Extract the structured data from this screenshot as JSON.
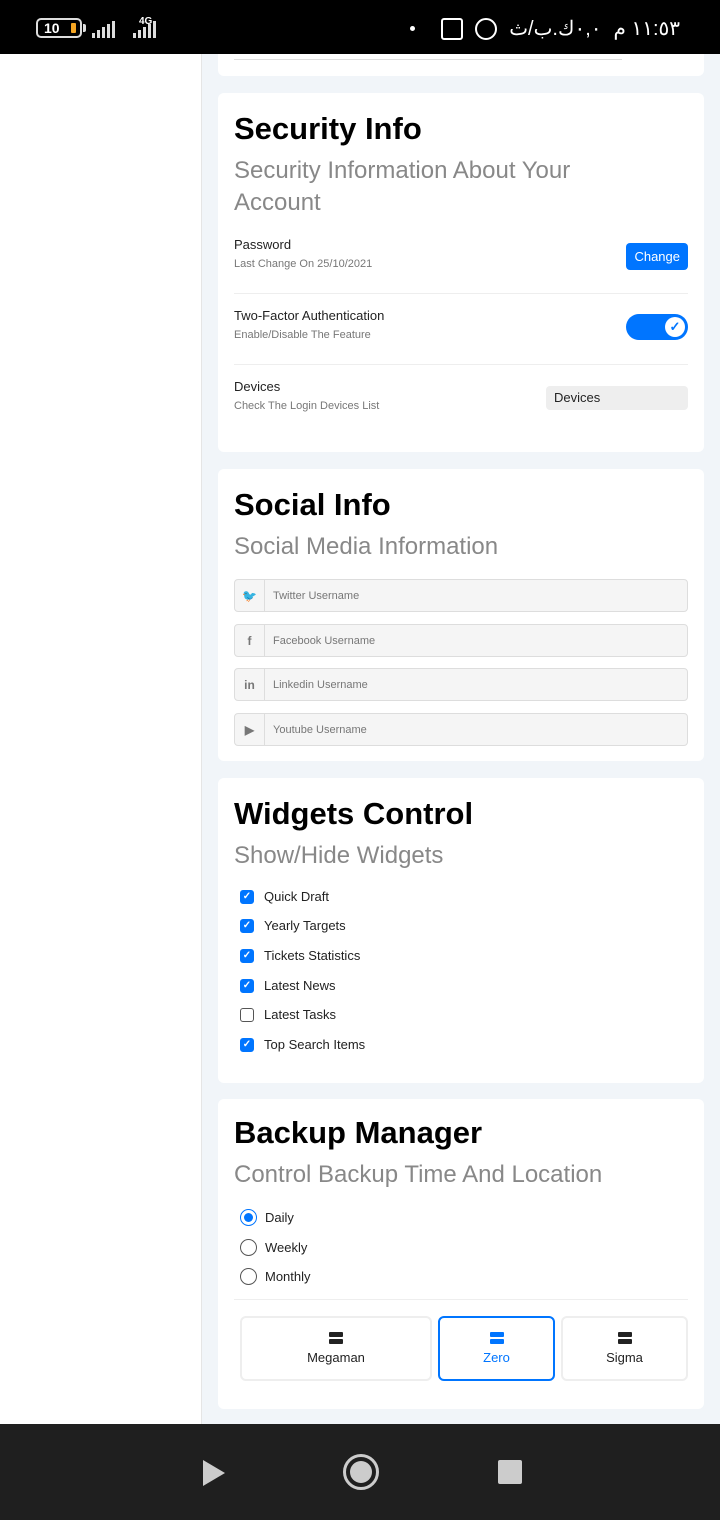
{
  "status_bar": {
    "battery": "10",
    "network": "4G",
    "date_text": "٠,٠ك.ب/ث",
    "time": "١١:٥٣ م"
  },
  "security": {
    "title": "Security Info",
    "subtitle": "Security Information About Your Account",
    "password_label": "Password",
    "password_desc": "Last Change On 25/10/2021",
    "change_label": "Change",
    "twofa_label": "Two-Factor Authentication",
    "twofa_desc": "Enable/Disable The Feature",
    "twofa_check": "✓",
    "devices_label": "Devices",
    "devices_desc": "Check The Login Devices List",
    "devices_button": "Devices"
  },
  "social": {
    "title": "Social Info",
    "subtitle": "Social Media Information",
    "fields": [
      {
        "icon": "twitter-icon",
        "glyph": "🐦",
        "placeholder": "Twitter Username"
      },
      {
        "icon": "facebook-icon",
        "glyph": "f",
        "placeholder": "Facebook Username"
      },
      {
        "icon": "linkedin-icon",
        "glyph": "in",
        "placeholder": "Linkedin Username"
      },
      {
        "icon": "youtube-icon",
        "glyph": "▶",
        "placeholder": "Youtube Username"
      }
    ]
  },
  "widgets": {
    "title": "Widgets Control",
    "subtitle": "Show/Hide Widgets",
    "check_mark": "✓",
    "items": [
      {
        "label": "Quick Draft",
        "checked": true
      },
      {
        "label": "Yearly Targets",
        "checked": true
      },
      {
        "label": "Tickets Statistics",
        "checked": true
      },
      {
        "label": "Latest News",
        "checked": true
      },
      {
        "label": "Latest Tasks",
        "checked": false
      },
      {
        "label": "Top Search Items",
        "checked": true
      }
    ]
  },
  "backup": {
    "title": "Backup Manager",
    "subtitle": "Control Backup Time And Location",
    "options": [
      {
        "label": "Daily",
        "selected": true
      },
      {
        "label": "Weekly",
        "selected": false
      },
      {
        "label": "Monthly",
        "selected": false
      }
    ],
    "servers": [
      {
        "label": "Megaman",
        "selected": false
      },
      {
        "label": "Zero",
        "selected": true
      },
      {
        "label": "Sigma",
        "selected": false
      }
    ],
    "accent": "#0075ff"
  }
}
